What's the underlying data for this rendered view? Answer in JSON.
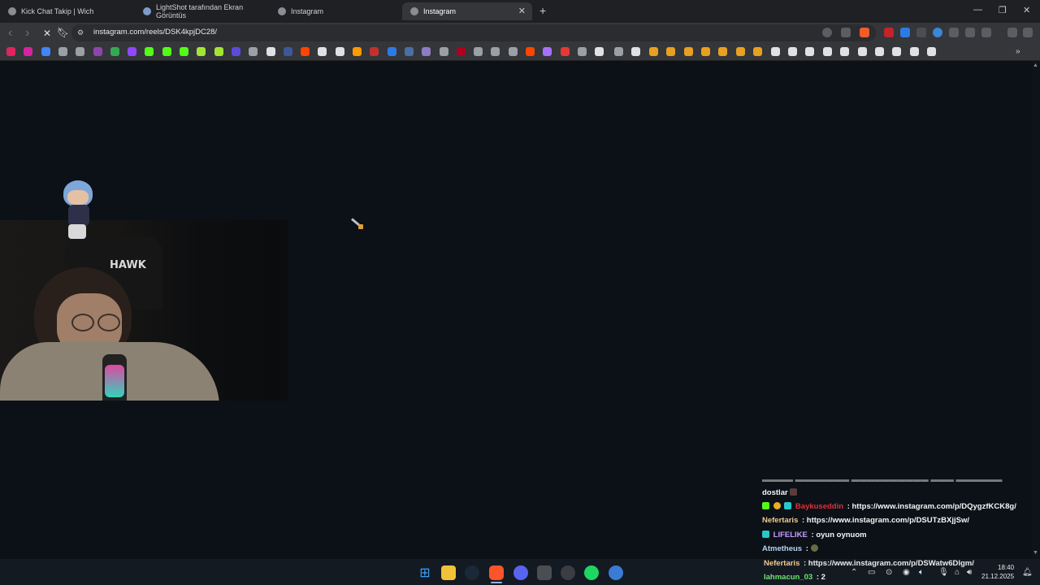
{
  "tabs": [
    {
      "title": "Kick Chat Takip | Wich",
      "icon": "globe-icon"
    },
    {
      "title": "LightShot tarafından Ekran Görüntüs",
      "icon": "feather-icon"
    },
    {
      "title": "Instagram",
      "icon": "globe-icon"
    },
    {
      "title": "Instagram",
      "icon": "globe-icon",
      "active": true
    }
  ],
  "new_tab_symbol": "+",
  "window_controls": {
    "minimize": "—",
    "restore": "❐",
    "close": "✕"
  },
  "toolbar": {
    "back": "‹",
    "forward": "›",
    "reload": "✕",
    "url": "instagram.com/reels/DSK4kpjDC28/"
  },
  "chat": {
    "lines": [
      {
        "user": "Baykuseddin",
        "user_color": "#e0303a",
        "text": ": https://www.instagram.com/p/DQygzfKCK8g/"
      },
      {
        "user": "Nefertaris",
        "user_color": "#f0c890",
        "text": ": https://www.instagram.com/p/DSUTzBXjjSw/"
      },
      {
        "user": "LIFELIKE",
        "user_color": "#c99cff",
        "text": ": oyun oynuom"
      },
      {
        "user": "Atmetheus",
        "user_color": "#b9d3f0",
        "text": ":"
      },
      {
        "user": "Nefertaris",
        "user_color": "#f0c890",
        "text": ": https://www.instagram.com/p/DSWatw6Dlgm/"
      },
      {
        "user": "lahmacun_03",
        "user_color": "#6fe36f",
        "text": ": 2"
      }
    ],
    "partial_line": "dostlar"
  },
  "webcam": {
    "chair_logo": "HAWK"
  },
  "clock": {
    "time": "18:40",
    "date": "21.12.2025"
  },
  "colors": {
    "tabbar": "#1f2023",
    "toolbar": "#35363a",
    "page_bg": "#0b1117",
    "taskbar": "#141a22"
  }
}
